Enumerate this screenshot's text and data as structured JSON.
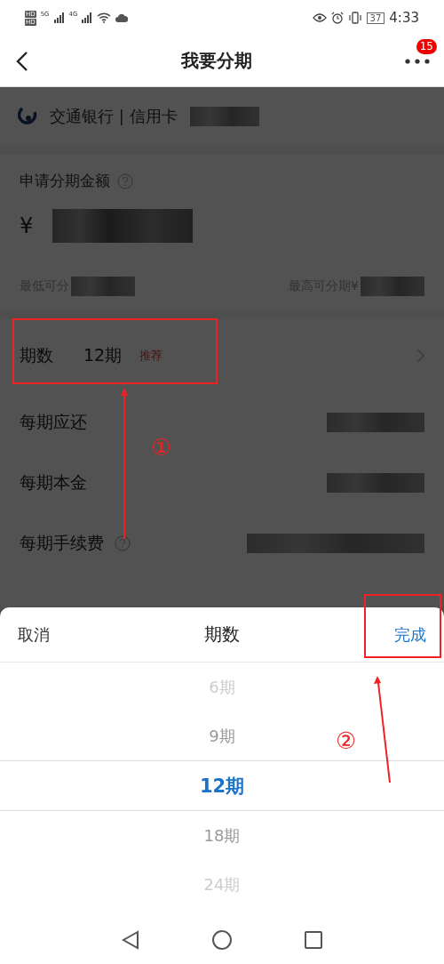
{
  "status_bar": {
    "network_labels": [
      "HD",
      "HD",
      "5G",
      "4G"
    ],
    "battery": "37",
    "time": "4:33"
  },
  "header": {
    "title": "我要分期",
    "badge": "15"
  },
  "bank": {
    "name": "交通银行 | 信用卡"
  },
  "amount": {
    "label": "申请分期金额",
    "currency": "¥",
    "min_label": "最低可分",
    "max_label": "最高可分期¥"
  },
  "term": {
    "label": "期数",
    "value": "12期",
    "tag": "推荐"
  },
  "rows": [
    {
      "label": "每期应还",
      "help": false
    },
    {
      "label": "每期本金",
      "help": false
    },
    {
      "label": "每期手续费",
      "help": true
    }
  ],
  "picker": {
    "cancel": "取消",
    "title": "期数",
    "done": "完成",
    "options": [
      {
        "label": "6期",
        "selected": false
      },
      {
        "label": "9期",
        "selected": false
      },
      {
        "label": "12期",
        "selected": true
      },
      {
        "label": "18期",
        "selected": false
      },
      {
        "label": "24期",
        "selected": false
      }
    ]
  },
  "annotations": [
    {
      "number": "①"
    },
    {
      "number": "②"
    }
  ]
}
